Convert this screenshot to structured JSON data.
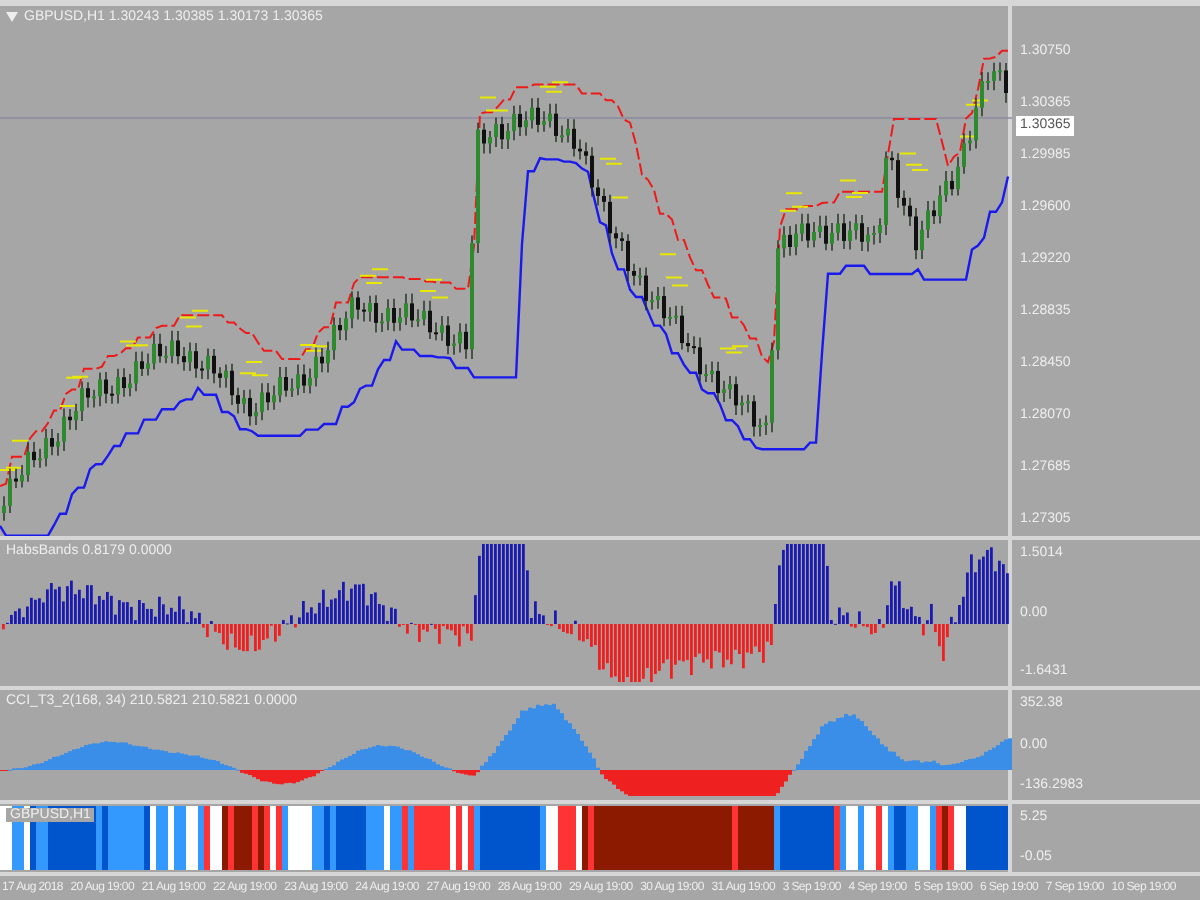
{
  "chart": {
    "title": "GBPUSD,H1  1.30243 1.30385 1.30173 1.30365",
    "price_axis": [
      "1.30750",
      "1.30365",
      "1.29985",
      "1.29600",
      "1.29220",
      "1.28835",
      "1.28450",
      "1.28070",
      "1.27685",
      "1.27305"
    ],
    "current_price": "1.30365"
  },
  "indicators": [
    {
      "title": "HabsBands 0.8179 0.0000",
      "kind": "histogram",
      "axis": [
        "1.5014",
        "0.00",
        "-1.6431"
      ]
    },
    {
      "title": "CCI_T3_2(168, 34) 210.5821 210.5821 0.0000",
      "kind": "area",
      "axis": [
        "352.38",
        "0.00",
        "-136.2983"
      ]
    },
    {
      "title": "GBPUSD,H1",
      "kind": "stripes",
      "axis": [
        "5.25",
        "-0.05"
      ]
    }
  ],
  "time_axis": [
    "17 Aug 2018",
    "20 Aug 19:00",
    "21 Aug 19:00",
    "22 Aug 19:00",
    "23 Aug 19:00",
    "24 Aug 19:00",
    "27 Aug 19:00",
    "28 Aug 19:00",
    "29 Aug 19:00",
    "30 Aug 19:00",
    "31 Aug 19:00",
    "3 Sep 19:00",
    "4 Sep 19:00",
    "5 Sep 19:00",
    "6 Sep 19:00",
    "7 Sep 19:00",
    "10 Sep 19:00"
  ]
}
